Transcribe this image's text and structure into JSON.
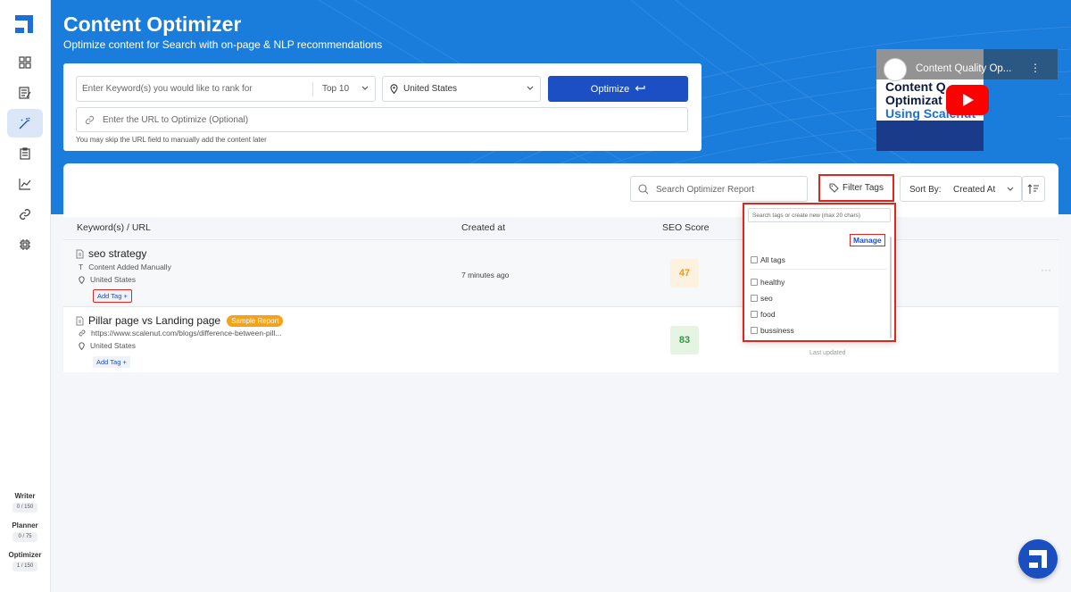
{
  "hero": {
    "title": "Content Optimizer",
    "subtitle": "Optimize content for Search with on-page & NLP recommendations"
  },
  "form": {
    "keyword_placeholder": "Enter Keyword(s) you would like to rank for",
    "top_n": "Top 10",
    "country": "United States",
    "optimize_label": "Optimize",
    "url_placeholder": "Enter the URL to Optimize (Optional)",
    "hint": "You may skip the URL field to manually add the content later"
  },
  "video": {
    "title": "Content Quality Op...",
    "line1": "Content Q",
    "line2": "Optimizat",
    "line3": "Using Scalenut"
  },
  "toolbar": {
    "search_placeholder": "Search Optimizer Report",
    "filter_label": "Filter Tags",
    "sort_label": "Sort By:",
    "sort_value": "Created At"
  },
  "table": {
    "headers": {
      "keyword": "Keyword(s) / URL",
      "created": "Created at",
      "score": "SEO Score"
    },
    "rows": [
      {
        "keyword": "seo strategy",
        "source": "Content Added Manually",
        "country": "United States",
        "add_tag": "Add Tag +",
        "created": "7 minutes ago",
        "score": "47"
      },
      {
        "keyword": "Pillar page vs Landing page",
        "badge": "Sample Report",
        "source": "https://www.scalenut.com/blogs/difference-between-pill...",
        "country": "United States",
        "add_tag": "Add Tag +",
        "score": "83",
        "last_updated": "Last updated"
      }
    ]
  },
  "tag_dropdown": {
    "search_placeholder": "Search tags or create new (max 20 chars)",
    "manage": "Manage",
    "all_tags": "All tags",
    "tags": [
      "healthy",
      "seo",
      "food",
      "bussiness"
    ]
  },
  "credits": [
    {
      "label": "Writer",
      "count": "0 / 150"
    },
    {
      "label": "Planner",
      "count": "0 / 75"
    },
    {
      "label": "Optimizer",
      "count": "1 / 150"
    }
  ],
  "colors": {
    "brand": "#1a7ddb",
    "button": "#1d4fc4",
    "highlight": "#e0261c",
    "score_mid": "#f5a21b",
    "score_good": "#2e9a3e"
  }
}
